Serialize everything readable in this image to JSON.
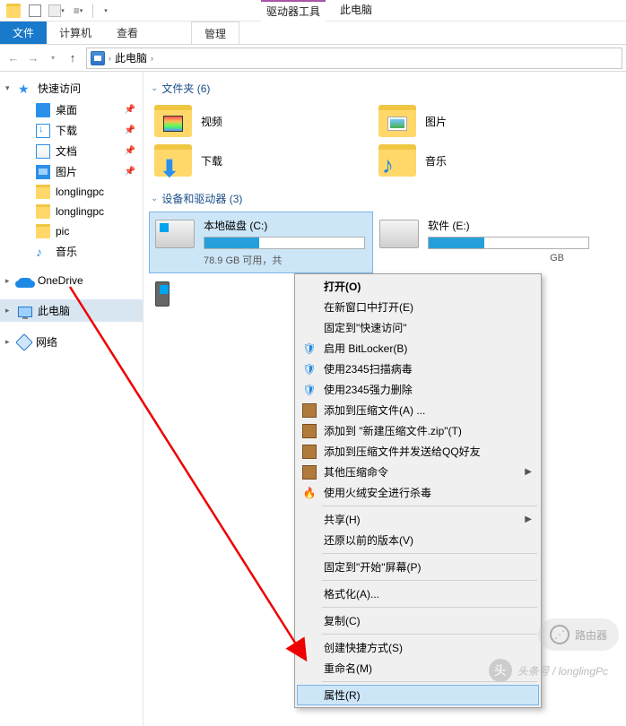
{
  "titlebar": {
    "drive_tools": "驱动器工具",
    "this_pc": "此电脑"
  },
  "ribbon": {
    "file": "文件",
    "computer": "计算机",
    "view": "查看",
    "manage": "管理"
  },
  "address": {
    "location": "此电脑"
  },
  "sidebar": {
    "quick_access": "快速访问",
    "desktop": "桌面",
    "downloads": "下载",
    "documents": "文档",
    "pictures": "图片",
    "f1": "longlingpc",
    "f2": "longlingpc",
    "f3": "pic",
    "music": "音乐",
    "onedrive": "OneDrive",
    "this_pc": "此电脑",
    "network": "网络"
  },
  "sections": {
    "folders_head": "文件夹 (6)",
    "drives_head": "设备和驱动器 (3)"
  },
  "folders": {
    "videos": "视频",
    "pictures": "图片",
    "downloads": "下载",
    "music": "音乐"
  },
  "drives": {
    "c_name": "本地磁盘 (C:)",
    "c_free": "78.9 GB 可用，共",
    "c_pct": 34,
    "e_name": "软件 (E:)",
    "e_free": "GB",
    "e_pct": 35
  },
  "ctx": {
    "open": "打开(O)",
    "open_new": "在新窗口中打开(E)",
    "pin_qa": "固定到\"快速访问\"",
    "bitlocker": "启用 BitLocker(B)",
    "scan2345": "使用2345扫描病毒",
    "del2345": "使用2345强力删除",
    "archive_a": "添加到压缩文件(A) ...",
    "archive_t": "添加到 \"新建压缩文件.zip\"(T)",
    "archive_qq": "添加到压缩文件并发送给QQ好友",
    "other_zip": "其他压缩命令",
    "huorong": "使用火绒安全进行杀毒",
    "share": "共享(H)",
    "restore": "还原以前的版本(V)",
    "pin_start": "固定到\"开始\"屏幕(P)",
    "format": "格式化(A)...",
    "copy": "复制(C)",
    "shortcut": "创建快捷方式(S)",
    "rename": "重命名(M)",
    "properties": "属性(R)"
  },
  "watermark": {
    "router": "路由器",
    "credit": "头条号 / longlingPc"
  }
}
